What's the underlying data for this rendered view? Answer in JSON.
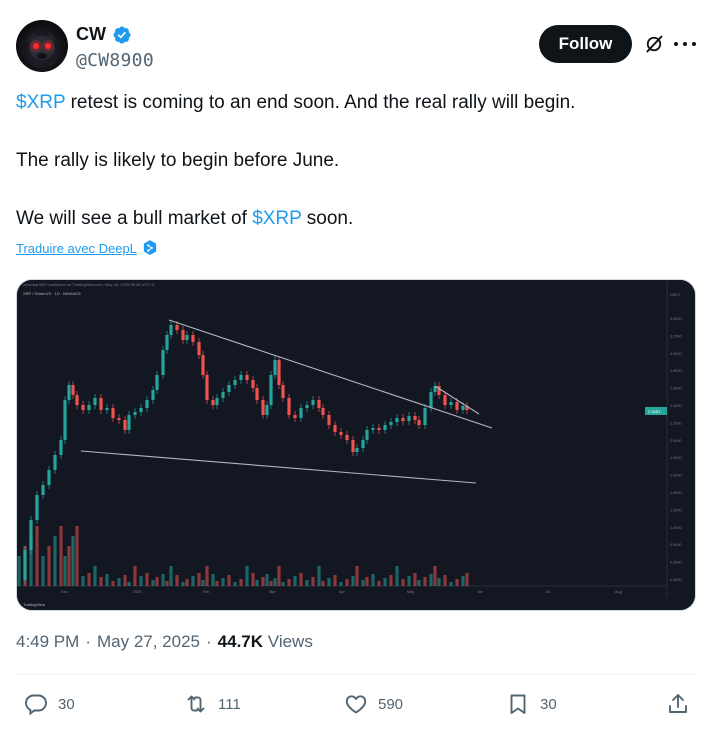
{
  "author": {
    "display_name": "CW",
    "handle": "@CW8900",
    "verified": true
  },
  "header_actions": {
    "follow_label": "Follow",
    "grok_icon": "grok-slash-icon",
    "more_icon": "more-icon"
  },
  "tweet": {
    "line1_cashtag": "$XRP",
    "line1_rest": " retest is coming to an end soon. And the real rally will begin.",
    "line2": "The rally is likely to begin before June.",
    "line3_prefix": "We will see a bull market of ",
    "line3_cashtag": "$XRP",
    "line3_suffix": " soon."
  },
  "translate_label": "Traduire avec DeepL",
  "chart": {
    "publisher_text": "crocobar0907 published on TradingView.com, May 26, 2025 08:48 UTC+9",
    "symbol_text": "XRP / TetherUS · 1D · BINANCE",
    "x_labels": [
      "Dec",
      "2025",
      "Feb",
      "Mar",
      "Apr",
      "May",
      "Jun",
      "Jul",
      "Aug"
    ],
    "y_labels": [
      "USDT",
      "3.4000",
      "3.2000",
      "3.0000",
      "2.8000",
      "2.6000",
      "2.4000",
      "2.2000",
      "2.0000",
      "1.8000",
      "1.6000",
      "1.4000",
      "1.2000",
      "1.0000",
      "0.8000",
      "0.6000",
      "0.4000"
    ],
    "price_tag": "2.3451",
    "watermark": "TradingView",
    "colors": {
      "up": "#26a69a",
      "down": "#ef5350",
      "line": "#b2b5be",
      "bg": "#131722"
    }
  },
  "meta": {
    "time": "4:49 PM",
    "sep1": "·",
    "date": "May 27, 2025",
    "sep2": "·",
    "views_count": "44.7K",
    "views_label": "Views"
  },
  "actions": {
    "replies": "30",
    "reposts": "111",
    "likes": "590",
    "bookmarks": "30"
  }
}
